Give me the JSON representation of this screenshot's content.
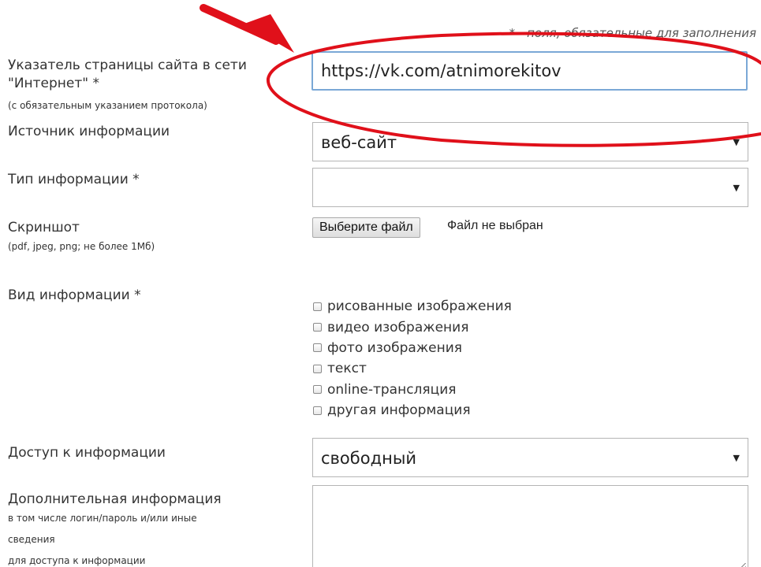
{
  "required_note": "* - поля, обязательные для заполнения",
  "fields": {
    "url": {
      "label_line1": "Указатель страницы сайта в сети",
      "label_line2": "\"Интернет\" *",
      "hint": "(с обязательным указанием протокола)",
      "value": "https://vk.com/atnimorekitov"
    },
    "source": {
      "label": "Источник информации",
      "value": "веб-сайт"
    },
    "info_type": {
      "label": "Тип информации *",
      "value": ""
    },
    "screenshot": {
      "label": "Скриншот",
      "hint": "(pdf, jpeg, png; не более 1Мб)",
      "button_label": "Выберите файл",
      "status": "Файл не выбран"
    },
    "info_kind": {
      "label": "Вид информации *",
      "options": [
        "рисованные изображения",
        "видео изображения",
        "фото изображения",
        "текст",
        "online-трансляция",
        "другая информация"
      ]
    },
    "access": {
      "label": "Доступ к информации",
      "value": "свободный"
    },
    "additional": {
      "label": "Дополнительная информация",
      "hint_line1": "в том числе логин/пароль и/или иные",
      "hint_line2": "сведения",
      "hint_line3": "для доступа к информации",
      "value": ""
    }
  },
  "icons": {
    "select_arrow": "▼"
  },
  "annotation": {
    "color": "#e0101a",
    "shapes": [
      "arrow-icon",
      "ellipse-highlight"
    ]
  }
}
